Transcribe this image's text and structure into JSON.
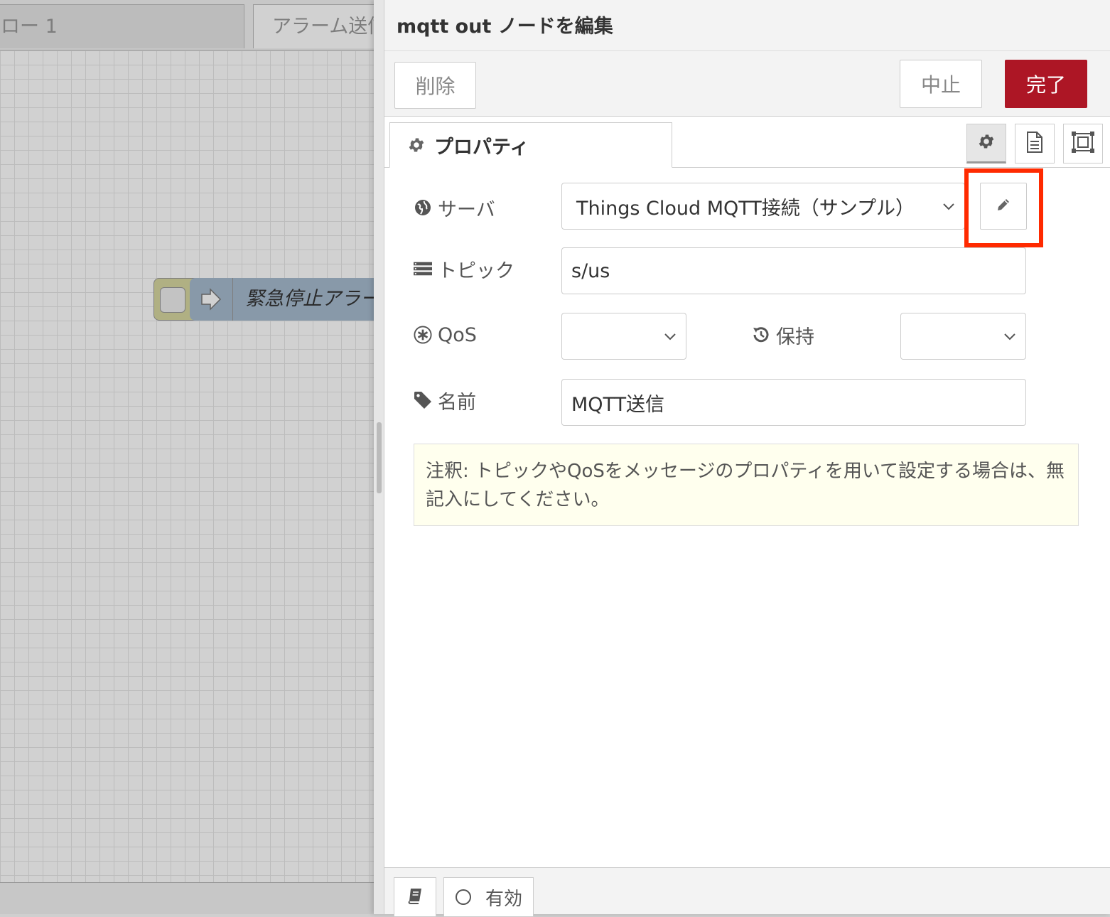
{
  "workspace": {
    "tabs": [
      {
        "label": "ロー 1"
      },
      {
        "label": "アラーム送信"
      }
    ],
    "node_label": "緊急停止アラート"
  },
  "tray": {
    "title": "mqtt out ノードを編集",
    "buttons": {
      "delete": "削除",
      "cancel": "中止",
      "done": "完了"
    },
    "tab_properties": "プロパティ",
    "form": {
      "server_label": "サーバ",
      "server_value": "Things Cloud MQTT接続（サンプル）",
      "topic_label": "トピック",
      "topic_value": "s/us",
      "qos_label": "QoS",
      "qos_value": "",
      "retain_label": "保持",
      "retain_value": "",
      "name_label": "名前",
      "name_value": "MQTT送信"
    },
    "note": "注釈: トピックやQoSをメッセージのプロパティを用いて設定する場合は、無記入にしてください。",
    "footer": {
      "enabled_label": "有効"
    }
  },
  "colors": {
    "done_button": "#ad1625",
    "highlight": "#ff2a00",
    "note_bg": "#ffffee"
  },
  "icons": [
    "gear-icon",
    "document-icon",
    "frame-icon",
    "globe-icon",
    "list-icon",
    "asterisk-icon",
    "history-icon",
    "tag-icon",
    "pencil-icon",
    "book-icon",
    "chevron-down-icon",
    "arrow-right-icon"
  ]
}
